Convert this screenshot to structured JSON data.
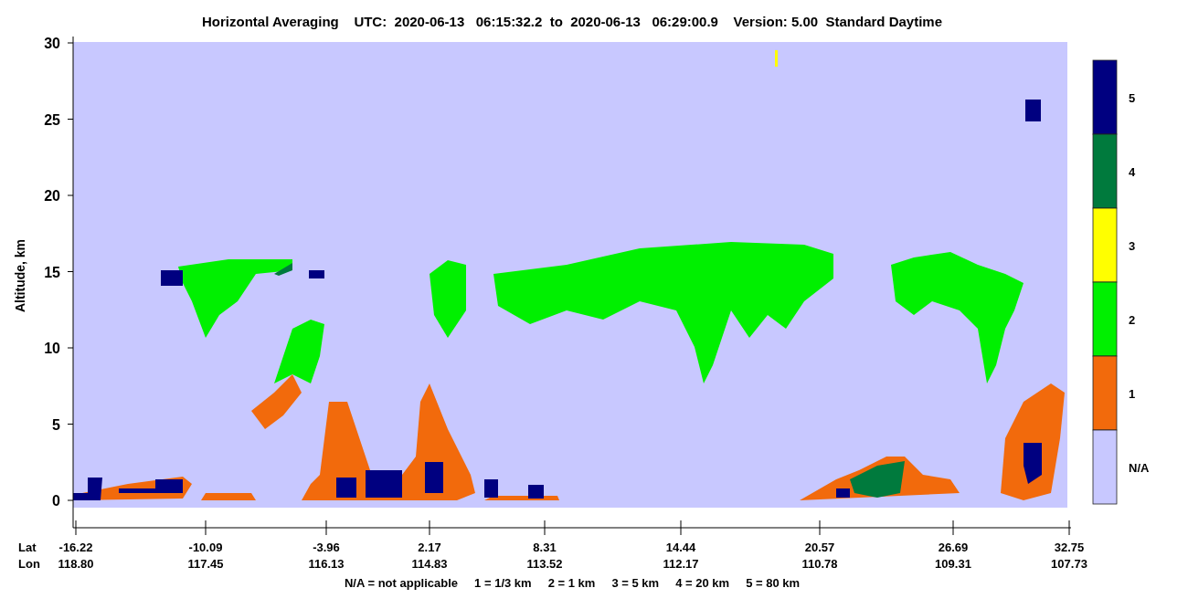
{
  "title": "Horizontal Averaging    UTC:  2020-06-13   06:15:32.2  to  2020-06-13   06:29:00.9    Version: 5.00  Standard Daytime",
  "y_axis": {
    "label": "Altitude, km",
    "ticks": [
      "30",
      "25",
      "20",
      "15",
      "10",
      "5",
      "0"
    ]
  },
  "x_axis": {
    "lat_label": "Lat",
    "lon_label": "Lon",
    "ticks": [
      {
        "lat": "-16.22",
        "lon": "118.80"
      },
      {
        "lat": "-10.09",
        "lon": "117.45"
      },
      {
        "lat": "-3.96",
        "lon": "116.13"
      },
      {
        "lat": "2.17",
        "lon": "114.83"
      },
      {
        "lat": "8.31",
        "lon": "113.52"
      },
      {
        "lat": "14.44",
        "lon": "112.17"
      },
      {
        "lat": "20.57",
        "lon": "110.78"
      },
      {
        "lat": "26.69",
        "lon": "109.31"
      },
      {
        "lat": "32.75",
        "lon": "107.73"
      }
    ]
  },
  "legend_note": "N/A = not applicable     1 = 1/3 km     2 = 1 km     3 = 5 km     4 = 20 km     5 = 80 km",
  "colorbar": [
    {
      "label": "5",
      "color": "#000080"
    },
    {
      "label": "4",
      "color": "#007a3d"
    },
    {
      "label": "3",
      "color": "#ffff00"
    },
    {
      "label": "2",
      "color": "#00f000"
    },
    {
      "label": "1",
      "color": "#f26a0c"
    },
    {
      "label": "N/A",
      "color": "#c8c8ff"
    }
  ]
}
